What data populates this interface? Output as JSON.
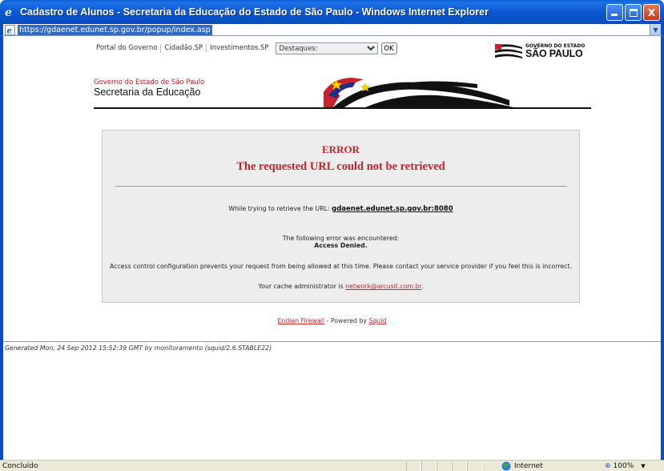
{
  "window": {
    "title": "Cadastro de Alunos - Secretaria da Educação do Estado de São Paulo - Windows Internet Explorer",
    "minimize_label": "_",
    "maximize_label": "□",
    "close_label": "X"
  },
  "address": {
    "url": "https://gdaenet.edunet.sp.gov.br/popup/index.asp"
  },
  "gov_nav": {
    "links": [
      "Portal do Governo",
      "Cidadão.SP",
      "Investimentos.SP"
    ],
    "select_value": "Destaques:",
    "ok_label": "OK",
    "logo_line1": "GOVERNO DO ESTADO",
    "logo_line2": "SÃO PAULO"
  },
  "header": {
    "gov_text": "Governo do Estado de São Paulo",
    "secretaria": "Secretaria da Educação"
  },
  "error": {
    "title": "ERROR",
    "subtitle": "The requested URL could not be retrieved",
    "trying_prefix": "While trying to retrieve the URL:",
    "trying_url": "gdaenet.edunet.sp.gov.br:8080",
    "encountered": "The following error was encountered:",
    "reason": "Access Denied.",
    "explanation": "Access control configuration prevents your request from being allowed at this time. Please contact your service provider if you feel this is incorrect.",
    "admin_prefix": "Your cache administrator is",
    "admin_email": "network@arcusit.com.br",
    "admin_suffix": "."
  },
  "footer": {
    "firewall": "Endian Firewall",
    "powered_by": " - Powered by ",
    "squid": "Squid"
  },
  "generated": "Generated Mon, 24 Sep 2012 15:52:39 GMT by monitoramento (squid/2.6.STABLE22)",
  "status": {
    "text": "Concluído",
    "zone": "Internet",
    "zoom": "100%"
  },
  "colors": {
    "titlebar": "#0a5fd6",
    "error_red": "#c8232c",
    "box_bg": "#ededed"
  }
}
